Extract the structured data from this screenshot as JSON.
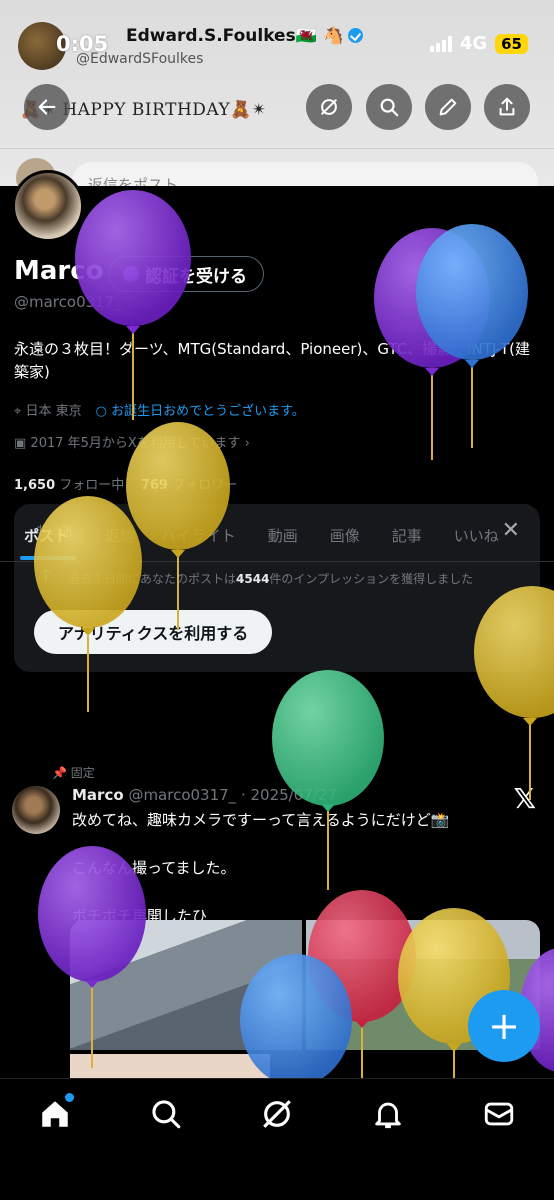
{
  "status_bar": {
    "time": "0:05",
    "network": "4G",
    "battery": "65"
  },
  "background_post": {
    "name": "Edward.S.Foulkes🏴󠁧󠁢󠁷󠁬󠁳󠁿 🐴",
    "handle": "@EdwardSFoulkes",
    "birthday_text": "🧸✴︎ HAPPY BIRTHDAY🧸✴︎",
    "reply_placeholder": "返信をポスト"
  },
  "profile": {
    "name": "Marco",
    "verify_label": "認証を受ける",
    "handle": "@marco0317_",
    "bio": "永遠の３枚目！ダーツ、MTG(Standard、Pioneer)、GTC、撮影、INTJ-T(建築家)",
    "location": "日本 東京",
    "birthday_msg": "お誕生日おめでとうございます。",
    "joined": "2017 年5月からXを利用しています",
    "following_count": "1,650",
    "following_label": "フォロー中",
    "followers_count": "769",
    "followers_label": "フォロワー"
  },
  "analytics_card": {
    "label": "非公開",
    "text_prefix": "過去７日間にあなたのポストは",
    "count": "4544",
    "text_suffix": "件のインプレッションを獲得しました",
    "button": "アナリティクスを利用する"
  },
  "tabs": [
    "ポスト",
    "返信",
    "ハイライト",
    "動画",
    "画像",
    "記事",
    "いいね"
  ],
  "pinned_post": {
    "pinned_label": "固定",
    "name": "Marco",
    "meta": "@marco0317_ · 2025/07/27",
    "text": "改めてね、趣味カメラですーって言えるようにだけど📸\n\nこんなん撮ってました。\n\nボチボチ再開したひ"
  },
  "fab_label": "+",
  "colors": {
    "accent": "#1d9bf0",
    "background": "#000000",
    "balloon_purple": "#8a2be2",
    "balloon_blue": "#3b8de0",
    "balloon_yellow": "#e8c22d",
    "balloon_green": "#3fcf8e",
    "balloon_red": "#e0304f"
  }
}
